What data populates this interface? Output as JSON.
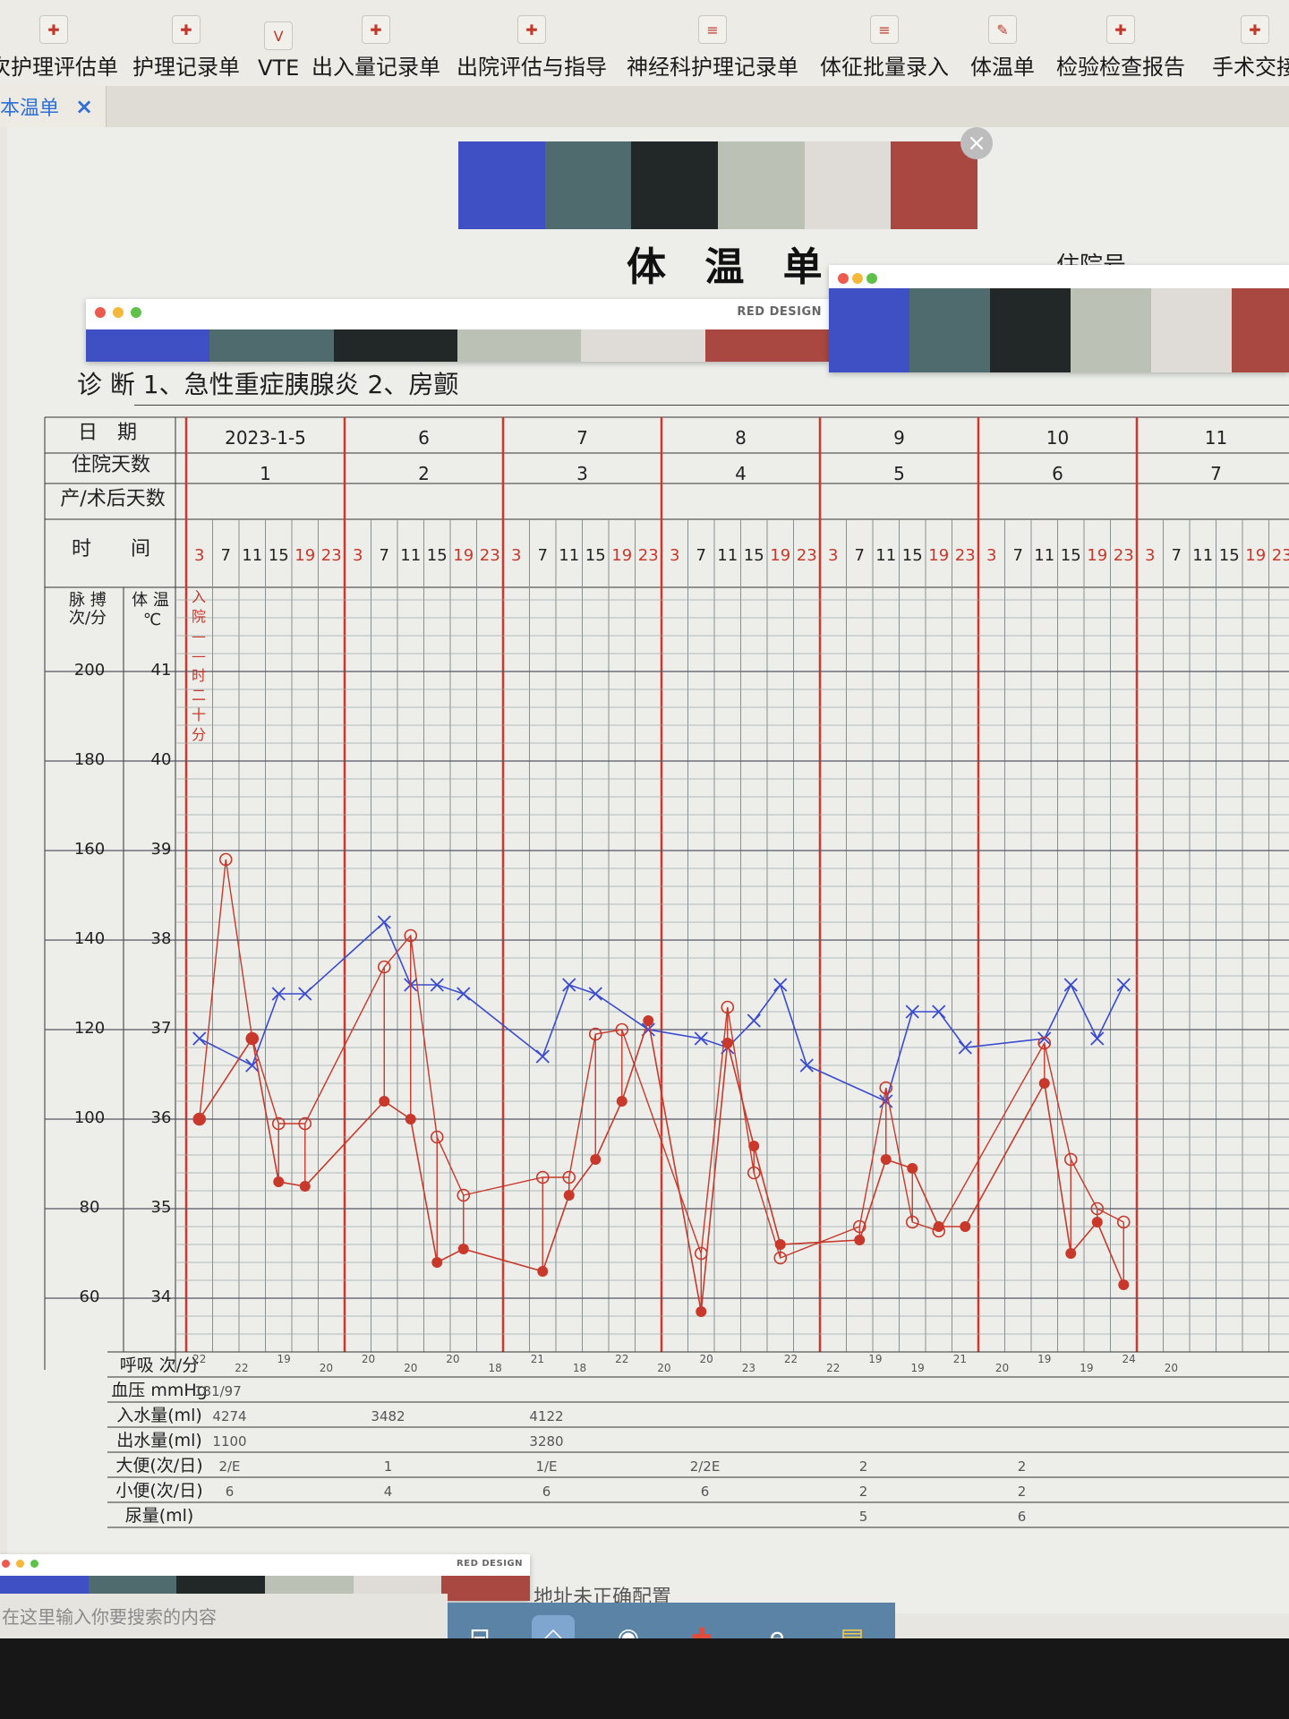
{
  "toolbar": {
    "items": [
      {
        "label": "次护理评估单",
        "x": -12,
        "icon": "form-icon"
      },
      {
        "label": "护理记录单",
        "x": 148,
        "icon": "form-icon"
      },
      {
        "label": "VTE",
        "x": 288,
        "icon": "vte-icon"
      },
      {
        "label": "出入量记录单",
        "x": 348,
        "icon": "form-icon"
      },
      {
        "label": "出院评估与指导",
        "x": 510,
        "icon": "form-icon"
      },
      {
        "label": "神经科护理记录单",
        "x": 700,
        "icon": "list-icon"
      },
      {
        "label": "体征批量录入",
        "x": 916,
        "icon": "list-icon"
      },
      {
        "label": "体温单",
        "x": 1084,
        "icon": "pen-icon"
      },
      {
        "label": "检验检查报告",
        "x": 1180,
        "icon": "form-icon"
      },
      {
        "label": "手术交接",
        "x": 1354,
        "icon": "form-icon"
      }
    ]
  },
  "tab": {
    "label": "本温单",
    "close": "×"
  },
  "document": {
    "title": "体 温 单",
    "admission_no_label": "住院号",
    "diagnosis": "诊 断 1、急性重症胰腺炎 2、房颤"
  },
  "palette": {
    "colors": [
      "#3f4fc4",
      "#4f6b6d",
      "#222827",
      "#bcc1b5",
      "#dfdcd8",
      "#a84840"
    ],
    "brand": "RED DESIGN"
  },
  "chart": {
    "row_labels": {
      "date": "日　期",
      "stay_days": "住院天数",
      "post_op_days": "产/术后天数",
      "time": "时　　间"
    },
    "axis_headers": {
      "pulse": "脉 搏\n次/分",
      "temp": "体 温\n℃"
    },
    "admit_note": [
      "入",
      "院",
      "—",
      "—",
      "时",
      "二",
      "十",
      "分"
    ],
    "bottom_labels": [
      "呼吸 次/分",
      "血压 mmHg",
      "入水量(ml)",
      "出水量(ml)",
      "大便(次/日)",
      "小便(次/日)",
      "尿量(ml)"
    ],
    "time_labels": [
      "3",
      "7",
      "11",
      "15",
      "19",
      "23"
    ]
  },
  "chart_data": {
    "type": "line",
    "title": "体温单",
    "days": [
      {
        "date": "2023-1-5",
        "stay": "1"
      },
      {
        "date": "6",
        "stay": "2"
      },
      {
        "date": "7",
        "stay": "3"
      },
      {
        "date": "8",
        "stay": "4"
      },
      {
        "date": "9",
        "stay": "5"
      },
      {
        "date": "10",
        "stay": "6"
      },
      {
        "date": "11",
        "stay": "7"
      }
    ],
    "pulse_axis": [
      200,
      180,
      160,
      140,
      120,
      100,
      80,
      60
    ],
    "temp_axis": [
      41,
      40,
      39,
      38,
      37,
      36,
      35,
      34
    ],
    "series": [
      {
        "name": "体温",
        "color": "#3a4bd0",
        "values": [
          [
            1,
            36.9
          ],
          [
            3,
            36.6
          ],
          [
            4,
            37.4
          ],
          [
            5,
            37.4
          ],
          [
            8,
            38.2
          ],
          [
            9,
            37.5
          ],
          [
            10,
            37.5
          ],
          [
            11,
            37.4
          ],
          [
            14,
            36.7
          ],
          [
            15,
            37.5
          ],
          [
            16,
            37.4
          ],
          [
            18,
            37.0
          ],
          [
            20,
            36.9
          ],
          [
            21,
            36.8
          ],
          [
            22,
            37.1
          ],
          [
            23,
            37.5
          ],
          [
            24,
            36.6
          ],
          [
            27,
            36.2
          ],
          [
            28,
            37.2
          ],
          [
            29,
            37.2
          ],
          [
            30,
            36.8
          ],
          [
            33,
            36.9
          ],
          [
            34,
            37.5
          ],
          [
            35,
            36.9
          ],
          [
            36,
            37.5
          ]
        ]
      },
      {
        "name": "脉搏",
        "color": "#c8382b",
        "filled": [
          [
            1,
            100
          ],
          [
            3,
            118
          ],
          [
            4,
            86
          ],
          [
            5,
            85
          ],
          [
            8,
            104
          ],
          [
            9,
            100
          ],
          [
            10,
            68
          ],
          [
            11,
            71
          ],
          [
            14,
            66
          ],
          [
            15,
            83
          ],
          [
            16,
            91
          ],
          [
            17,
            104
          ],
          [
            18,
            122
          ],
          [
            20,
            57
          ],
          [
            21,
            117
          ],
          [
            22,
            94
          ],
          [
            23,
            72
          ],
          [
            26,
            73
          ],
          [
            27,
            91
          ],
          [
            28,
            89
          ],
          [
            29,
            76
          ],
          [
            30,
            76
          ],
          [
            33,
            108
          ],
          [
            34,
            70
          ],
          [
            35,
            77
          ],
          [
            36,
            63
          ]
        ],
        "open": [
          [
            1,
            100
          ],
          [
            2,
            158
          ],
          [
            3,
            118
          ],
          [
            4,
            99
          ],
          [
            5,
            99
          ],
          [
            8,
            134
          ],
          [
            9,
            141
          ],
          [
            10,
            96
          ],
          [
            11,
            83
          ],
          [
            14,
            87
          ],
          [
            15,
            87
          ],
          [
            16,
            119
          ],
          [
            17,
            120
          ],
          [
            20,
            70
          ],
          [
            21,
            125
          ],
          [
            22,
            88
          ],
          [
            23,
            69
          ],
          [
            26,
            76
          ],
          [
            27,
            107
          ],
          [
            28,
            77
          ],
          [
            29,
            75
          ],
          [
            33,
            117
          ],
          [
            34,
            91
          ],
          [
            35,
            80
          ],
          [
            36,
            77
          ]
        ]
      }
    ],
    "breathing": [
      "22",
      "22",
      "19",
      "20",
      "20",
      "20",
      "20",
      "18",
      "21",
      "18",
      "22",
      "20",
      "20",
      "23",
      "22",
      "22",
      "19",
      "19",
      "21",
      "20",
      "19",
      "19",
      "24",
      "20"
    ],
    "blood_pressure": "181/97",
    "intake": [
      "4274",
      "3482",
      "4122"
    ],
    "output": [
      "1100",
      "",
      "3280"
    ],
    "stool": [
      "2/E",
      "1",
      "1/E",
      "2/2E",
      "2",
      "2"
    ],
    "urine": [
      "6",
      "4",
      "6",
      "6",
      "2",
      "2"
    ],
    "urine_ml": [
      "",
      "",
      "",
      "",
      "5",
      "6"
    ]
  },
  "status": {
    "search_placeholder": "在这里输入你要搜索的内容",
    "address_note": "地址未正确配置"
  }
}
